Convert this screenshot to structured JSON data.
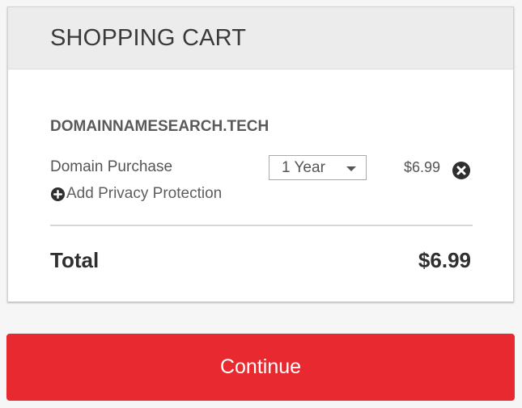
{
  "cart": {
    "title": "SHOPPING CART",
    "domain": "DOMAINNAMESEARCH.TECH",
    "item": {
      "label": "Domain Purchase",
      "term": "1 Year",
      "price": "$6.99",
      "remove_icon": "close-circle-icon"
    },
    "privacy": {
      "label": "Add Privacy Protection",
      "icon": "plus-circle-icon"
    },
    "total": {
      "label": "Total",
      "value": "$6.99"
    }
  },
  "actions": {
    "continue_label": "Continue"
  },
  "colors": {
    "accent": "#e8292f",
    "header_bg": "#ececec",
    "page_bg": "#f6f6f6"
  }
}
